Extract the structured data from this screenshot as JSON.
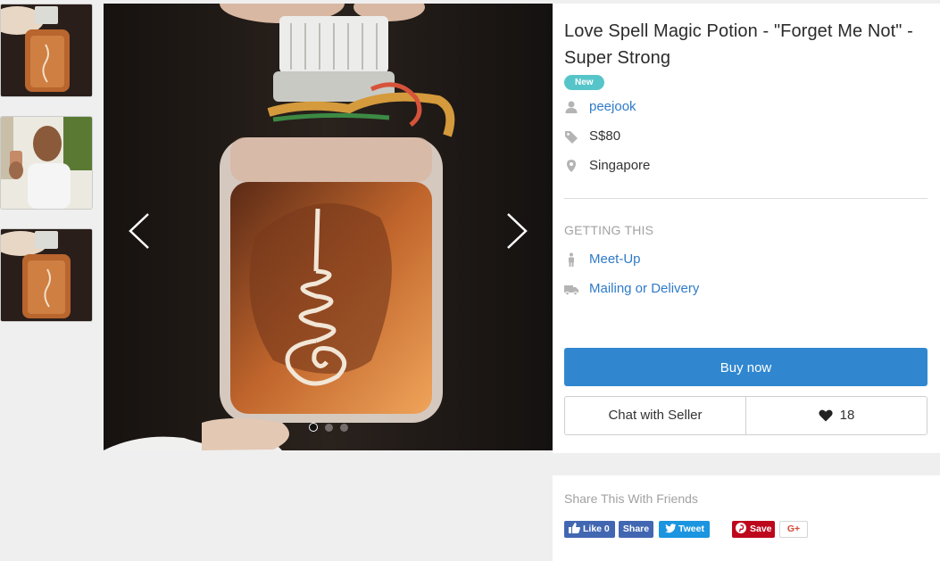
{
  "thumbnails": [
    {
      "alt": "bottle-photo-1"
    },
    {
      "alt": "seller-holding-bottle"
    },
    {
      "alt": "bottle-photo-2"
    }
  ],
  "gallery": {
    "slide_count": 3,
    "active_index": 0
  },
  "listing": {
    "title": "Love Spell Magic Potion - \"Forget Me Not\" - Super Strong",
    "badge": "New",
    "seller": "peejook",
    "price": "S$80",
    "location": "Singapore"
  },
  "getting_this": {
    "label": "GETTING THIS",
    "options": [
      "Meet-Up",
      "Mailing or Delivery"
    ]
  },
  "actions": {
    "buy_label": "Buy now",
    "chat_label": "Chat with Seller",
    "like_count": "18"
  },
  "share": {
    "title": "Share This With Friends",
    "fb_like": "Like 0",
    "fb_share": "Share",
    "tweet": "Tweet",
    "pin": "Save",
    "gplus": "G+"
  },
  "colors": {
    "accent": "#3087d0",
    "badge": "#56c5c9",
    "link": "#2f7ac7"
  }
}
